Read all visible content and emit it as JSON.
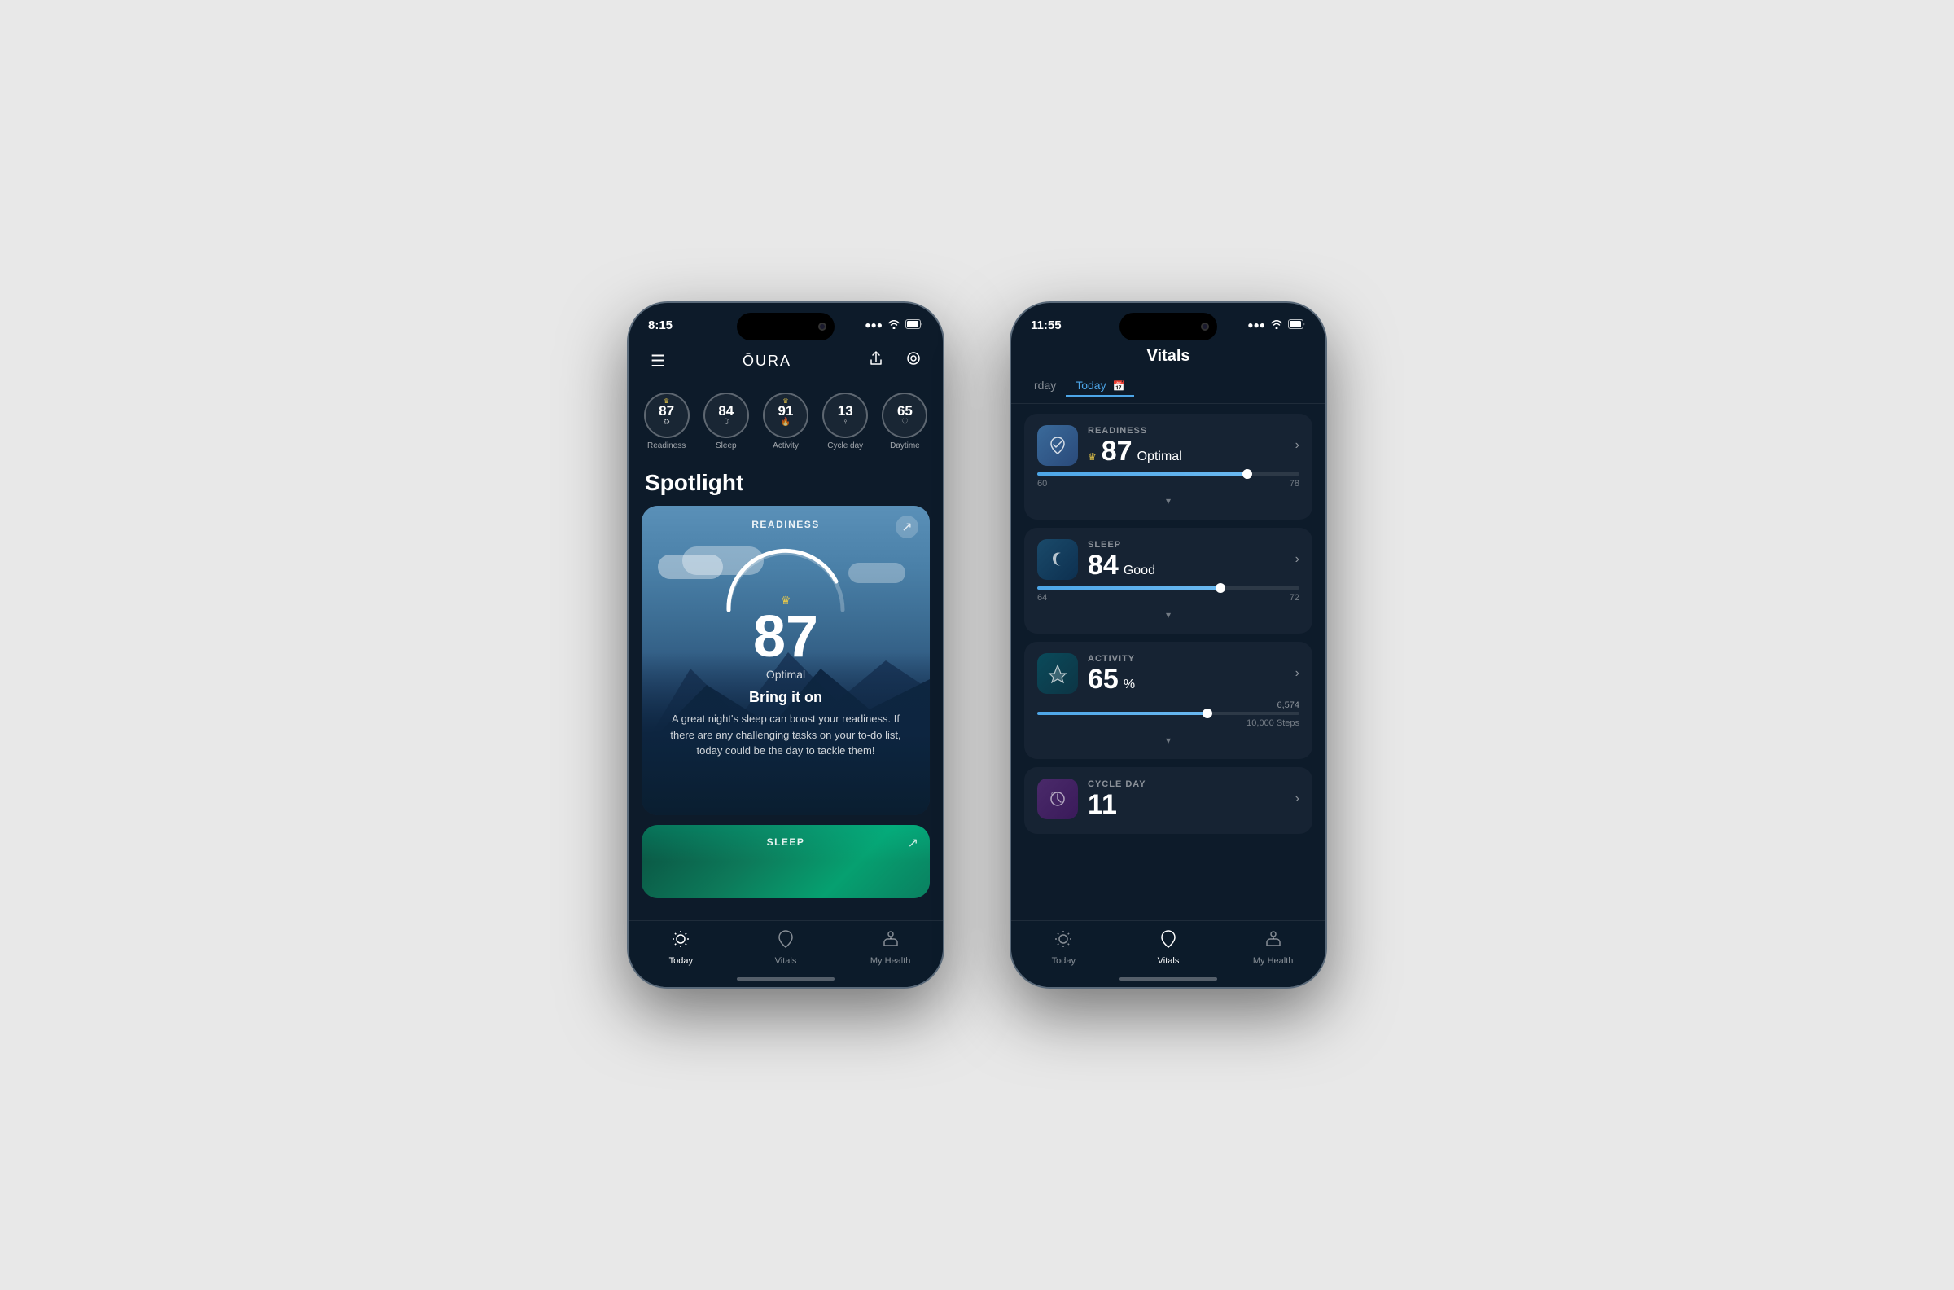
{
  "left_phone": {
    "status_bar": {
      "time": "8:15",
      "signal": "▲▲▲",
      "wifi": "wifi",
      "battery": "battery"
    },
    "nav": {
      "menu_icon": "☰",
      "title": "ŌURA",
      "share_icon": "↑",
      "target_icon": "◎"
    },
    "scores": [
      {
        "number": "87",
        "label": "Readiness",
        "icon": "♻",
        "has_crown": true
      },
      {
        "number": "84",
        "label": "Sleep",
        "icon": "☽",
        "has_crown": false
      },
      {
        "number": "91",
        "label": "Activity",
        "icon": "🔥",
        "has_crown": true
      },
      {
        "number": "13",
        "label": "Cycle day",
        "icon": "♀",
        "has_crown": false
      },
      {
        "number": "65",
        "label": "Daytime",
        "icon": "♡",
        "has_crown": false
      }
    ],
    "spotlight": {
      "title": "Spotlight",
      "readiness_card": {
        "label": "READINESS",
        "score": "87",
        "status": "Optimal",
        "cta": "Bring it on",
        "description": "A great night's sleep can boost your readiness. If there are any challenging tasks on your to-do list, today could be the day to tackle them!"
      },
      "sleep_card": {
        "label": "SLEEP"
      }
    },
    "tabs": [
      {
        "label": "Today",
        "icon": "☀",
        "active": true
      },
      {
        "label": "Vitals",
        "icon": "♻",
        "active": false
      },
      {
        "label": "My Health",
        "icon": "🌿",
        "active": false
      }
    ]
  },
  "right_phone": {
    "status_bar": {
      "time": "11:55",
      "signal": "▲▲▲",
      "wifi": "wifi",
      "battery": "battery"
    },
    "header": {
      "title": "Vitals"
    },
    "date_tabs": [
      {
        "label": "rday",
        "active": false
      },
      {
        "label": "Today",
        "active": true,
        "icon": "📅"
      }
    ],
    "vitals": [
      {
        "category": "READINESS",
        "score": "87",
        "label": "Optimal",
        "has_crown": true,
        "icon": "♻",
        "icon_class": "vital-icon-readiness",
        "progress_fill": 80,
        "progress_start": "60",
        "progress_end": "78",
        "has_expand": true
      },
      {
        "category": "SLEEP",
        "score": "84",
        "label": "Good",
        "has_crown": false,
        "icon": "☽",
        "icon_class": "vital-icon-sleep",
        "progress_fill": 70,
        "progress_start": "64",
        "progress_end": "72",
        "has_expand": true
      },
      {
        "category": "ACTIVITY",
        "score": "65",
        "label": "%",
        "has_crown": false,
        "icon": "🔥",
        "icon_class": "vital-icon-activity",
        "progress_fill": 65,
        "steps_count": "6,574",
        "steps_goal": "10,000 Steps",
        "has_expand": true
      },
      {
        "category": "CYCLE DAY",
        "score": "11",
        "label": "",
        "has_crown": false,
        "icon": "♀",
        "icon_class": "vital-icon-cycle",
        "has_expand": false
      }
    ],
    "tabs": [
      {
        "label": "Today",
        "icon": "☀",
        "active": false
      },
      {
        "label": "Vitals",
        "icon": "♻",
        "active": true
      },
      {
        "label": "My Health",
        "icon": "🌿",
        "active": false
      }
    ]
  }
}
